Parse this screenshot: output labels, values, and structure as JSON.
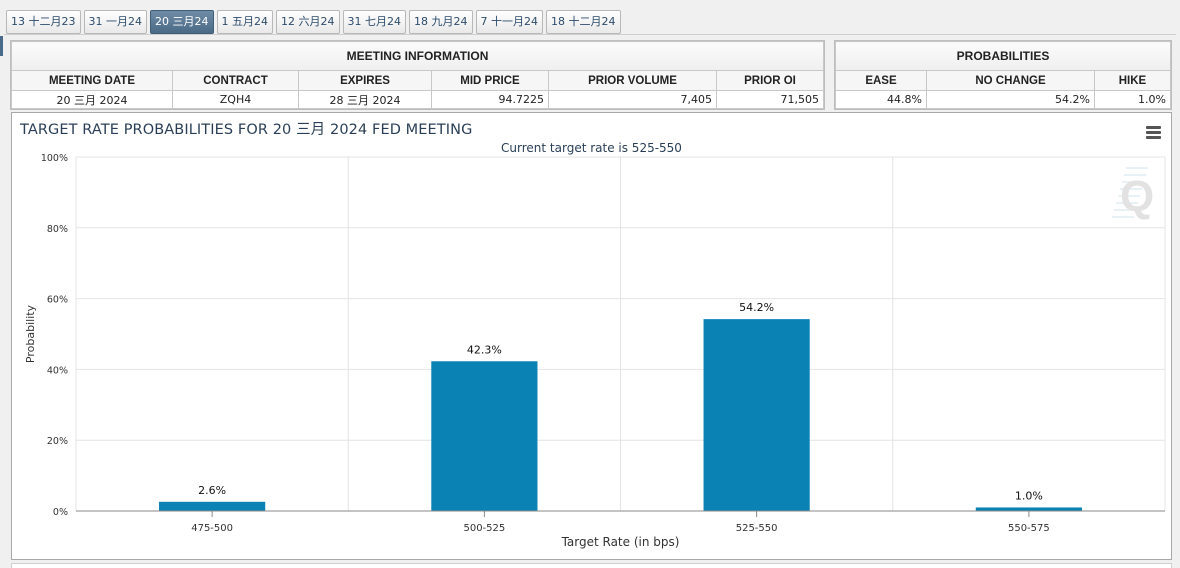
{
  "tabs": [
    {
      "label": "13 十二月23",
      "active": false
    },
    {
      "label": "31 一月24",
      "active": false
    },
    {
      "label": "20 三月24",
      "active": true
    },
    {
      "label": "1 五月24",
      "active": false
    },
    {
      "label": "12 六月24",
      "active": false
    },
    {
      "label": "31 七月24",
      "active": false
    },
    {
      "label": "18 九月24",
      "active": false
    },
    {
      "label": "7 十一月24",
      "active": false
    },
    {
      "label": "18 十二月24",
      "active": false
    }
  ],
  "meeting_info": {
    "section_title": "MEETING INFORMATION",
    "headers": [
      "MEETING DATE",
      "CONTRACT",
      "EXPIRES",
      "MID PRICE",
      "PRIOR VOLUME",
      "PRIOR OI"
    ],
    "row": [
      "20 三月 2024",
      "ZQH4",
      "28 三月 2024",
      "94.7225",
      "7,405",
      "71,505"
    ]
  },
  "probabilities": {
    "section_title": "PROBABILITIES",
    "headers": [
      "EASE",
      "NO CHANGE",
      "HIKE"
    ],
    "row": [
      "44.8%",
      "54.2%",
      "1.0%"
    ]
  },
  "chart_data": {
    "type": "bar",
    "title": "TARGET RATE PROBABILITIES FOR 20 三月 2024 FED MEETING",
    "subtitle": "Current target rate is 525-550",
    "xlabel": "Target Rate (in bps)",
    "ylabel": "Probability",
    "categories": [
      "475-500",
      "500-525",
      "525-550",
      "550-575"
    ],
    "values": [
      2.6,
      42.3,
      54.2,
      1.0
    ],
    "data_labels": [
      "2.6%",
      "42.3%",
      "54.2%",
      "1.0%"
    ],
    "ylim": [
      0,
      100
    ],
    "yticks": [
      "0%",
      "20%",
      "40%",
      "60%",
      "80%",
      "100%"
    ],
    "grid": true,
    "bar_color": "#0a82b4",
    "watermark": "Q"
  }
}
